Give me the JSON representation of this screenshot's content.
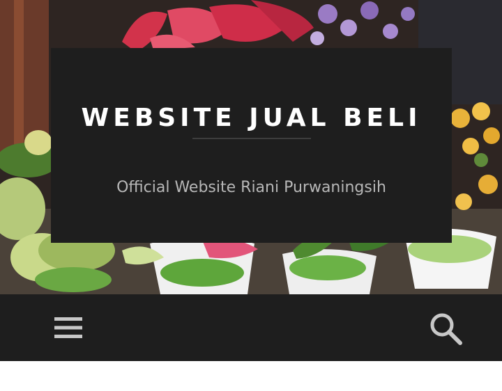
{
  "header": {
    "site_title": "WEBSITE JUAL BELI",
    "tagline": "Official Website Riani Purwaningsih"
  },
  "navbar": {
    "menu_icon": "hamburger-menu-icon",
    "search_icon": "search-icon"
  },
  "colors": {
    "title_box": "#1e1e1e",
    "navbar": "#1e1e1e",
    "title_text": "#ffffff",
    "tagline_text": "#b8b8b8",
    "icon": "#c8c8c8"
  }
}
